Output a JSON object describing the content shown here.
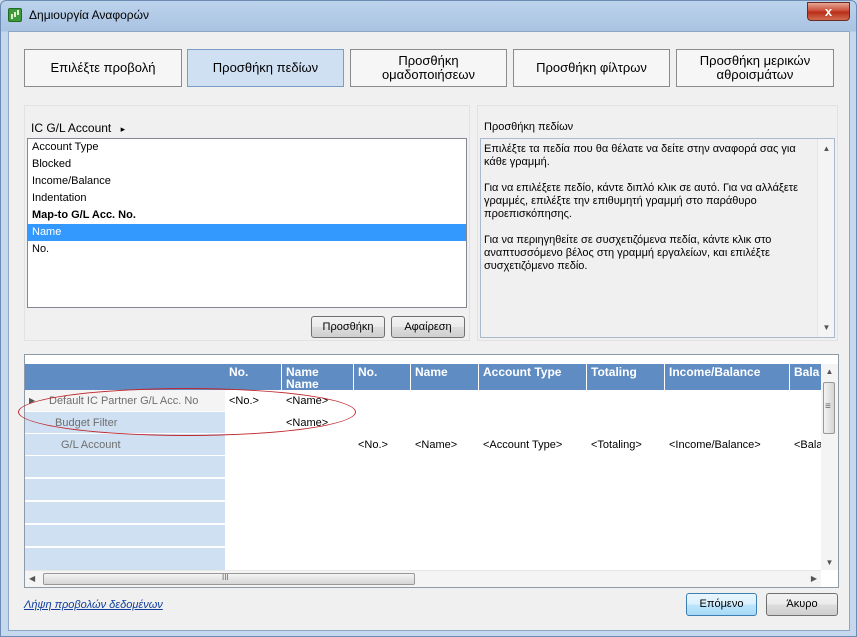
{
  "window": {
    "title": "Δημιουργία Αναφορών",
    "close_glyph": "x"
  },
  "steps": [
    {
      "label": "Επιλέξτε προβολή",
      "active": false
    },
    {
      "label": "Προσθήκη πεδίων",
      "active": true
    },
    {
      "label": "Προσθήκη ομαδοποιήσεων",
      "active": false
    },
    {
      "label": "Προσθήκη φίλτρων",
      "active": false
    },
    {
      "label": "Προσθήκη μερικών αθροισμάτων",
      "active": false
    }
  ],
  "fields_panel": {
    "source_label": "IC G/L Account",
    "arrow_glyph": "▸",
    "items": [
      {
        "label": "Account Type",
        "bold": false,
        "selected": false
      },
      {
        "label": "Blocked",
        "bold": false,
        "selected": false
      },
      {
        "label": "Income/Balance",
        "bold": false,
        "selected": false
      },
      {
        "label": "Indentation",
        "bold": false,
        "selected": false
      },
      {
        "label": "Map-to G/L Acc. No.",
        "bold": true,
        "selected": false
      },
      {
        "label": "Name",
        "bold": false,
        "selected": true
      },
      {
        "label": "No.",
        "bold": false,
        "selected": false
      }
    ],
    "add_button": "Προσθήκη",
    "remove_button": "Αφαίρεση"
  },
  "help_panel": {
    "title": "Προσθήκη πεδίων",
    "paragraphs": [
      "Επιλέξτε τα πεδία που θα θέλατε να δείτε στην αναφορά σας για κάθε γραμμή.",
      "Για να επιλέξετε πεδίο, κάντε διπλό κλικ σε αυτό. Για να αλλάξετε γραμμές, επιλέξτε την επιθυμητή γραμμή στο παράθυρο προεπισκόπησης.",
      "Για να περιηγηθείτε σε συσχετιζόμενα πεδία, κάντε κλικ στο αναπτυσσόμενο βέλος στη γραμμή εργαλείων, και επιλέξτε συσχετιζόμενο πεδίο."
    ]
  },
  "grid": {
    "columns": [
      "No.",
      "Name Name",
      "No.",
      "Name",
      "Account Type",
      "Totaling",
      "Income/Balance",
      "Bala"
    ],
    "rows": [
      {
        "label": "Default IC Partner G/L Acc. No",
        "indicator": "▶",
        "cells": [
          "<No.>",
          "<Name>",
          "",
          "",
          "",
          "",
          "",
          ""
        ]
      },
      {
        "label": "Budget Filter",
        "indicator": "",
        "cells": [
          "",
          "<Name>",
          "",
          "",
          "",
          "",
          "",
          ""
        ]
      },
      {
        "label": "G/L Account",
        "indicator": "",
        "cells": [
          "",
          "",
          "<No.>",
          "<Name>",
          "<Account Type>",
          "<Totaling>",
          "<Income/Balance>",
          "<Bala"
        ]
      }
    ],
    "scroll_glyphs": {
      "up": "▲",
      "down": "▼",
      "left": "◀",
      "right": "▶",
      "grip": "III",
      "vgrip": "≡"
    }
  },
  "footer": {
    "link": "Λήψη προβολών δεδομένων",
    "next_button": "Επόμενο",
    "cancel_button": "Άκυρο"
  }
}
